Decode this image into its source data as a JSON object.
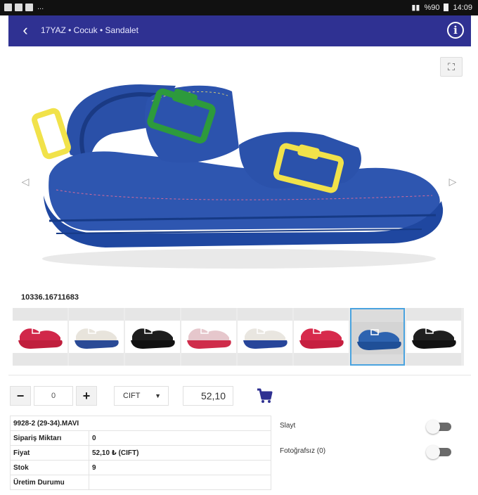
{
  "statusbar": {
    "dots": "...",
    "right_text": "%90",
    "time": "14:09"
  },
  "appbar": {
    "title": "17YAZ • Cocuk • Sandalet",
    "back_icon": "arrow-left-icon",
    "info_icon": "info-icon",
    "info_glyph": "i"
  },
  "viewer": {
    "expand_icon": "expand-icon",
    "prev_icon": "chevron-left-icon",
    "next_icon": "chevron-right-icon"
  },
  "product": {
    "code": "10336.16711683"
  },
  "thumbnails": [
    {
      "color": "#d1274a",
      "sole": "#c01f3d",
      "selected": false
    },
    {
      "color": "#e8e4dc",
      "sole": "#2a4a96",
      "selected": false
    },
    {
      "color": "#1d1d1d",
      "sole": "#111111",
      "selected": false
    },
    {
      "color": "#e6c7cc",
      "sole": "#cf2c4a",
      "selected": false
    },
    {
      "color": "#e9e6e0",
      "sole": "#27459a",
      "selected": false
    },
    {
      "color": "#d72a4c",
      "sole": "#c61f40",
      "selected": false
    },
    {
      "color": "#2d63b0",
      "sole": "#1f4f97",
      "selected": true
    },
    {
      "color": "#1f1f1f",
      "sole": "#121212",
      "selected": false
    }
  ],
  "order": {
    "minus_label": "−",
    "plus_label": "+",
    "quantity": "0",
    "unit": "CIFT",
    "price": "52,10",
    "cart_icon": "cart-icon"
  },
  "details": {
    "variant": "9928-2 (29-34).MAVI",
    "rows": [
      {
        "label": "Sipariş Miktarı",
        "value": "0"
      },
      {
        "label": "Fiyat",
        "value": "52,10 ₺ (CIFT)"
      },
      {
        "label": "Stok",
        "value": "9"
      },
      {
        "label": "Üretim Durumu",
        "value": ""
      }
    ]
  },
  "toggles": [
    {
      "label": "Slayt",
      "on": false
    },
    {
      "label": "Fotoğrafsız (0)",
      "on": false
    }
  ],
  "colors": {
    "appbar": "#2f3192",
    "sandal_blue": "#2e56b0",
    "buckle_yellow": "#f1e24a",
    "buckle_green": "#2d9a3c",
    "selected_border": "#4aa3df",
    "cart": "#2f3192"
  }
}
